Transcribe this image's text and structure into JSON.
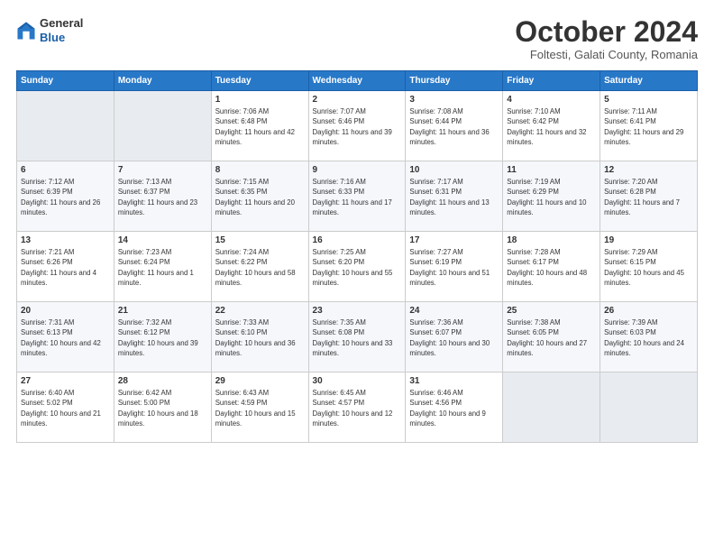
{
  "header": {
    "logo": {
      "line1": "General",
      "line2": "Blue"
    },
    "title": "October 2024",
    "subtitle": "Foltesti, Galati County, Romania"
  },
  "days_of_week": [
    "Sunday",
    "Monday",
    "Tuesday",
    "Wednesday",
    "Thursday",
    "Friday",
    "Saturday"
  ],
  "weeks": [
    [
      {
        "day": "",
        "info": ""
      },
      {
        "day": "",
        "info": ""
      },
      {
        "day": "1",
        "info": "Sunrise: 7:06 AM\nSunset: 6:48 PM\nDaylight: 11 hours and 42 minutes."
      },
      {
        "day": "2",
        "info": "Sunrise: 7:07 AM\nSunset: 6:46 PM\nDaylight: 11 hours and 39 minutes."
      },
      {
        "day": "3",
        "info": "Sunrise: 7:08 AM\nSunset: 6:44 PM\nDaylight: 11 hours and 36 minutes."
      },
      {
        "day": "4",
        "info": "Sunrise: 7:10 AM\nSunset: 6:42 PM\nDaylight: 11 hours and 32 minutes."
      },
      {
        "day": "5",
        "info": "Sunrise: 7:11 AM\nSunset: 6:41 PM\nDaylight: 11 hours and 29 minutes."
      }
    ],
    [
      {
        "day": "6",
        "info": "Sunrise: 7:12 AM\nSunset: 6:39 PM\nDaylight: 11 hours and 26 minutes."
      },
      {
        "day": "7",
        "info": "Sunrise: 7:13 AM\nSunset: 6:37 PM\nDaylight: 11 hours and 23 minutes."
      },
      {
        "day": "8",
        "info": "Sunrise: 7:15 AM\nSunset: 6:35 PM\nDaylight: 11 hours and 20 minutes."
      },
      {
        "day": "9",
        "info": "Sunrise: 7:16 AM\nSunset: 6:33 PM\nDaylight: 11 hours and 17 minutes."
      },
      {
        "day": "10",
        "info": "Sunrise: 7:17 AM\nSunset: 6:31 PM\nDaylight: 11 hours and 13 minutes."
      },
      {
        "day": "11",
        "info": "Sunrise: 7:19 AM\nSunset: 6:29 PM\nDaylight: 11 hours and 10 minutes."
      },
      {
        "day": "12",
        "info": "Sunrise: 7:20 AM\nSunset: 6:28 PM\nDaylight: 11 hours and 7 minutes."
      }
    ],
    [
      {
        "day": "13",
        "info": "Sunrise: 7:21 AM\nSunset: 6:26 PM\nDaylight: 11 hours and 4 minutes."
      },
      {
        "day": "14",
        "info": "Sunrise: 7:23 AM\nSunset: 6:24 PM\nDaylight: 11 hours and 1 minute."
      },
      {
        "day": "15",
        "info": "Sunrise: 7:24 AM\nSunset: 6:22 PM\nDaylight: 10 hours and 58 minutes."
      },
      {
        "day": "16",
        "info": "Sunrise: 7:25 AM\nSunset: 6:20 PM\nDaylight: 10 hours and 55 minutes."
      },
      {
        "day": "17",
        "info": "Sunrise: 7:27 AM\nSunset: 6:19 PM\nDaylight: 10 hours and 51 minutes."
      },
      {
        "day": "18",
        "info": "Sunrise: 7:28 AM\nSunset: 6:17 PM\nDaylight: 10 hours and 48 minutes."
      },
      {
        "day": "19",
        "info": "Sunrise: 7:29 AM\nSunset: 6:15 PM\nDaylight: 10 hours and 45 minutes."
      }
    ],
    [
      {
        "day": "20",
        "info": "Sunrise: 7:31 AM\nSunset: 6:13 PM\nDaylight: 10 hours and 42 minutes."
      },
      {
        "day": "21",
        "info": "Sunrise: 7:32 AM\nSunset: 6:12 PM\nDaylight: 10 hours and 39 minutes."
      },
      {
        "day": "22",
        "info": "Sunrise: 7:33 AM\nSunset: 6:10 PM\nDaylight: 10 hours and 36 minutes."
      },
      {
        "day": "23",
        "info": "Sunrise: 7:35 AM\nSunset: 6:08 PM\nDaylight: 10 hours and 33 minutes."
      },
      {
        "day": "24",
        "info": "Sunrise: 7:36 AM\nSunset: 6:07 PM\nDaylight: 10 hours and 30 minutes."
      },
      {
        "day": "25",
        "info": "Sunrise: 7:38 AM\nSunset: 6:05 PM\nDaylight: 10 hours and 27 minutes."
      },
      {
        "day": "26",
        "info": "Sunrise: 7:39 AM\nSunset: 6:03 PM\nDaylight: 10 hours and 24 minutes."
      }
    ],
    [
      {
        "day": "27",
        "info": "Sunrise: 6:40 AM\nSunset: 5:02 PM\nDaylight: 10 hours and 21 minutes."
      },
      {
        "day": "28",
        "info": "Sunrise: 6:42 AM\nSunset: 5:00 PM\nDaylight: 10 hours and 18 minutes."
      },
      {
        "day": "29",
        "info": "Sunrise: 6:43 AM\nSunset: 4:59 PM\nDaylight: 10 hours and 15 minutes."
      },
      {
        "day": "30",
        "info": "Sunrise: 6:45 AM\nSunset: 4:57 PM\nDaylight: 10 hours and 12 minutes."
      },
      {
        "day": "31",
        "info": "Sunrise: 6:46 AM\nSunset: 4:56 PM\nDaylight: 10 hours and 9 minutes."
      },
      {
        "day": "",
        "info": ""
      },
      {
        "day": "",
        "info": ""
      }
    ]
  ]
}
